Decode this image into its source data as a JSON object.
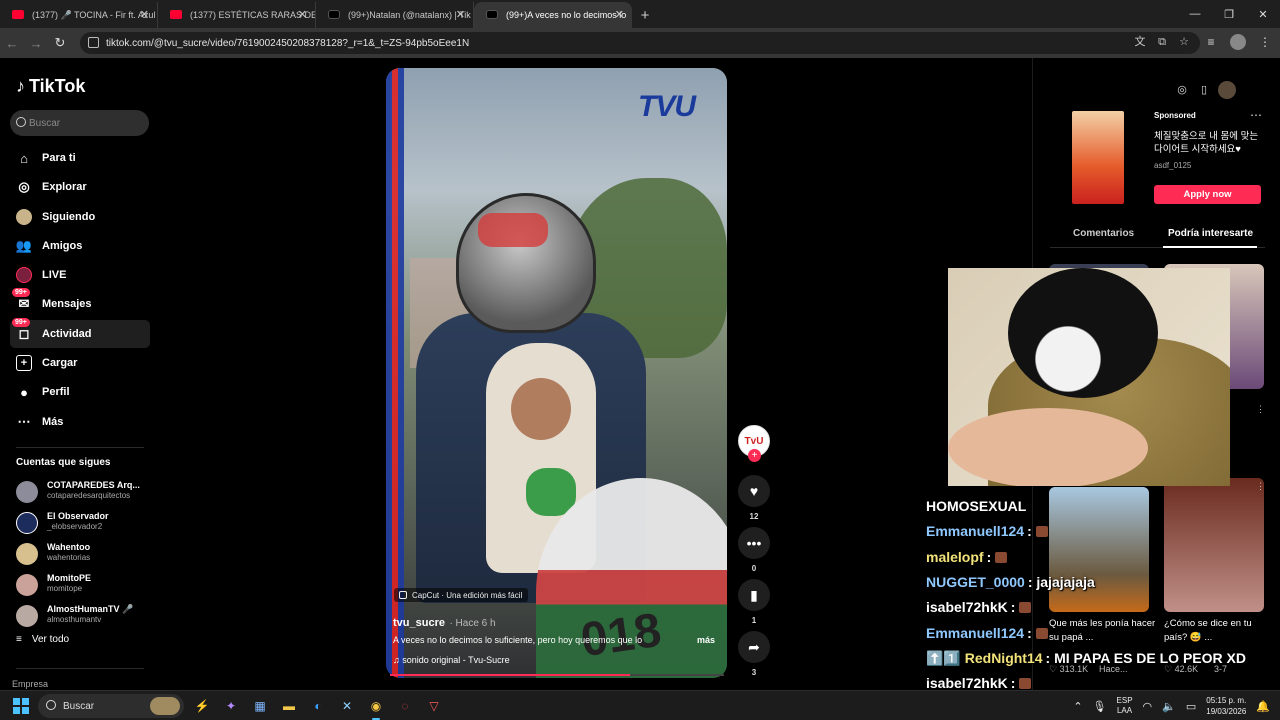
{
  "browser": {
    "tabs": [
      {
        "title": "(1377) 🎤 TOCINA - Fir ft. Azul",
        "favicon": "youtube-icon",
        "active": false
      },
      {
        "title": "(1377) ESTÉTICAS RARAS DE IN",
        "favicon": "youtube-icon",
        "active": false
      },
      {
        "title": "(99+)Natalan (@natalanx) | Tik",
        "favicon": "tiktok-icon",
        "active": false
      },
      {
        "title": "(99+)A veces no lo decimos lo",
        "favicon": "tiktok-icon",
        "active": true
      }
    ],
    "url": "tiktok.com/@tvu_sucre/video/7619002450208378128?_r=1&_t=ZS-94pb5oEee1N"
  },
  "tiktok": {
    "logo_text": "TikTok",
    "search_placeholder": "Buscar",
    "nav": [
      {
        "label": "Para ti",
        "icon": "home-icon"
      },
      {
        "label": "Explorar",
        "icon": "compass-icon"
      },
      {
        "label": "Siguiendo",
        "icon": "following-avatar-icon"
      },
      {
        "label": "Amigos",
        "icon": "friends-icon"
      },
      {
        "label": "LIVE",
        "icon": "live-icon"
      },
      {
        "label": "Mensajes",
        "icon": "messages-icon",
        "badge": "99+"
      },
      {
        "label": "Actividad",
        "icon": "activity-icon",
        "badge": "99+"
      },
      {
        "label": "Cargar",
        "icon": "upload-icon"
      },
      {
        "label": "Perfil",
        "icon": "profile-icon"
      },
      {
        "label": "Más",
        "icon": "more-icon"
      }
    ],
    "following_title": "Cuentas que sigues",
    "following": [
      {
        "name": "COTAPAREDES Arq...",
        "handle": "cotaparedesarquitectos"
      },
      {
        "name": "El Observador",
        "handle": "_elobservador2"
      },
      {
        "name": "Wahentoo",
        "handle": "wahentorias"
      },
      {
        "name": "MomitoPE",
        "handle": "momitope"
      },
      {
        "name": "AlmostHumanTV 🎤",
        "handle": "almosthumantv"
      }
    ],
    "see_all": "Ver todo",
    "footer_section": "Empresa"
  },
  "video": {
    "brand_overlay": "TVU",
    "capcut_label": "CapCut · Una edición más fácil",
    "author": "tvu_sucre",
    "time": "· Hace 6 h",
    "caption": "A veces no lo decimos lo suficiente, pero hoy queremos que lo",
    "more": "más",
    "sound": "♫  sonido original - Tvu-Sucre",
    "plate_number": "018",
    "progress": 0.72,
    "likes": "12",
    "comments": "0",
    "saves": "1",
    "shares": "3"
  },
  "right_panel": {
    "ad": {
      "sponsored": "Sponsored",
      "text": "체질맞춤으로 내 몸에 맞는 다이어트 시작하세요♥",
      "advertiser": "asdf_0125",
      "cta": "Apply now"
    },
    "tabs": [
      "Comentarios",
      "Podría interesarte"
    ],
    "active_tab": "Podría interesarte",
    "cards": [
      {
        "title": "Que más les ponía hacer su papá ...",
        "views": "♡ 313.1K",
        "time": "Hace..."
      },
      {
        "title": "¿Cómo se dice en tu país? 😅 ...",
        "views": "♡ 42.6K",
        "time": "3-7"
      }
    ]
  },
  "chat": [
    {
      "user": "HOMOSEXUAL",
      "text": "",
      "emote": false,
      "style": "w"
    },
    {
      "user": "Emmanuell124",
      "text": ":",
      "emote": true,
      "style": "b"
    },
    {
      "user": "malelopf",
      "text": ":",
      "emote": true,
      "style": "y"
    },
    {
      "user": "NUGGET_0000",
      "text": ": jajajajaja",
      "emote": false,
      "style": "b"
    },
    {
      "user": "isabel72hkK",
      "text": ":",
      "emote": true,
      "style": "w"
    },
    {
      "user": "Emmanuell124",
      "text": ":",
      "emote": true,
      "style": "b"
    },
    {
      "user": "⬆️1️⃣ RedNight14",
      "text": ": MI PAPA ES DE LO PEOR XD",
      "emote": false,
      "style": "y"
    },
    {
      "user": "isabel72hkK",
      "text": ":",
      "emote": true,
      "style": "w"
    }
  ],
  "taskbar": {
    "search_placeholder": "Buscar",
    "lang": "ESP",
    "lang2": "LAA",
    "time": "05:15 p. m.",
    "date": "19/03/2026"
  }
}
